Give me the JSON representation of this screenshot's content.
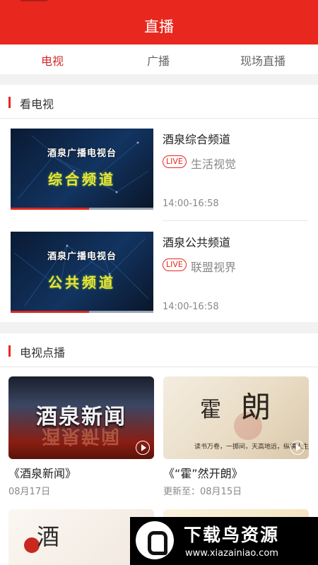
{
  "header": {
    "title": "直播"
  },
  "tabs": [
    {
      "label": "电视",
      "active": true
    },
    {
      "label": "广播",
      "active": false
    },
    {
      "label": "现场直播",
      "active": false
    }
  ],
  "tv_section": {
    "title": "看电视",
    "channels": [
      {
        "thumb_sub": "酒泉广播电视台",
        "thumb_big": "综合频道",
        "name": "酒泉综合频道",
        "live_badge": "LIVE",
        "program": "生活视觉",
        "time": "14:00-16:58",
        "progress": 0.55
      },
      {
        "thumb_sub": "酒泉广播电视台",
        "thumb_big": "公共频道",
        "name": "酒泉公共频道",
        "live_badge": "LIVE",
        "program": "联盟视界",
        "time": "14:00-16:58",
        "progress": 0.55
      }
    ]
  },
  "vod_section": {
    "title": "电视点播",
    "items": [
      {
        "img_text": "酒泉新闻",
        "title": "《酒泉新闻》",
        "date": "08月17日"
      },
      {
        "img_text_1": "霍",
        "img_text_2": "朗",
        "img_caption": "读书万卷，一掷间，天高地远，纵横人生",
        "title": "《“霍”然开朗》",
        "date": "更新至：08月15日"
      },
      {
        "img_text": "酒"
      },
      {
        "img_text": ""
      }
    ]
  },
  "watermark": {
    "brand": "下载鸟资源",
    "url": "www.xiazainiao.com"
  },
  "colors": {
    "accent": "#e8281e",
    "header_bg": "#e8281e"
  }
}
